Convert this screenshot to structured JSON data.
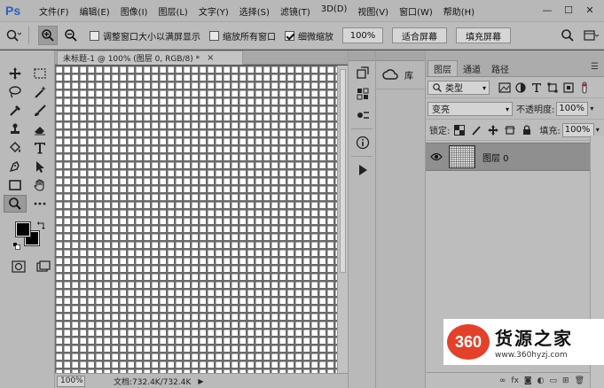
{
  "app": {
    "logo": "Ps",
    "menu": [
      "文件(F)",
      "编辑(E)",
      "图像(I)",
      "图层(L)",
      "文字(Y)",
      "选择(S)",
      "滤镜(T)",
      "3D(D)",
      "视图(V)",
      "窗口(W)",
      "帮助(H)"
    ],
    "window_controls": [
      "—",
      "☐",
      "✕"
    ]
  },
  "options_bar": {
    "resize_windows_label": "调整窗口大小以满屏显示",
    "zoom_all_windows_label": "缩放所有窗口",
    "scrubby_zoom_label": "细微缩放",
    "zoom_percent": "100%",
    "fit_screen_label": "适合屏幕",
    "fill_screen_label": "填充屏幕",
    "checks": {
      "resize_windows": false,
      "zoom_all_windows": false,
      "scrubby_zoom": true
    }
  },
  "document": {
    "tab_title": "未标题-1 @ 100% (图层 0, RGB/8) *",
    "close_glyph": "×"
  },
  "status": {
    "zoom": "100%",
    "doc_info": "文档:732.4K/732.4K",
    "arrow": "▶"
  },
  "library": {
    "label": "库"
  },
  "layers_panel": {
    "tabs": [
      "图层",
      "通道",
      "路径"
    ],
    "active_tab": 0,
    "filter_kind": "类型",
    "blend_mode": "变亮",
    "opacity_label": "不透明度:",
    "opacity_value": "100%",
    "lock_label": "锁定:",
    "fill_label": "填充:",
    "fill_value": "100%",
    "layers": [
      {
        "name": "图层 0",
        "visible": true
      }
    ],
    "footer_icons": [
      "链接",
      "fx",
      "蒙版",
      "调整",
      "组",
      "新建",
      "删除"
    ]
  },
  "watermark": {
    "badge": "360",
    "title": "货源之家",
    "url": "www.360hyzj.com"
  },
  "colors": {
    "ps_blue": "#2a62c6",
    "canvas_grid_cell": "#ffffff",
    "canvas_grid_line": "#6a6a6a",
    "watermark_red": "#e4412b"
  }
}
